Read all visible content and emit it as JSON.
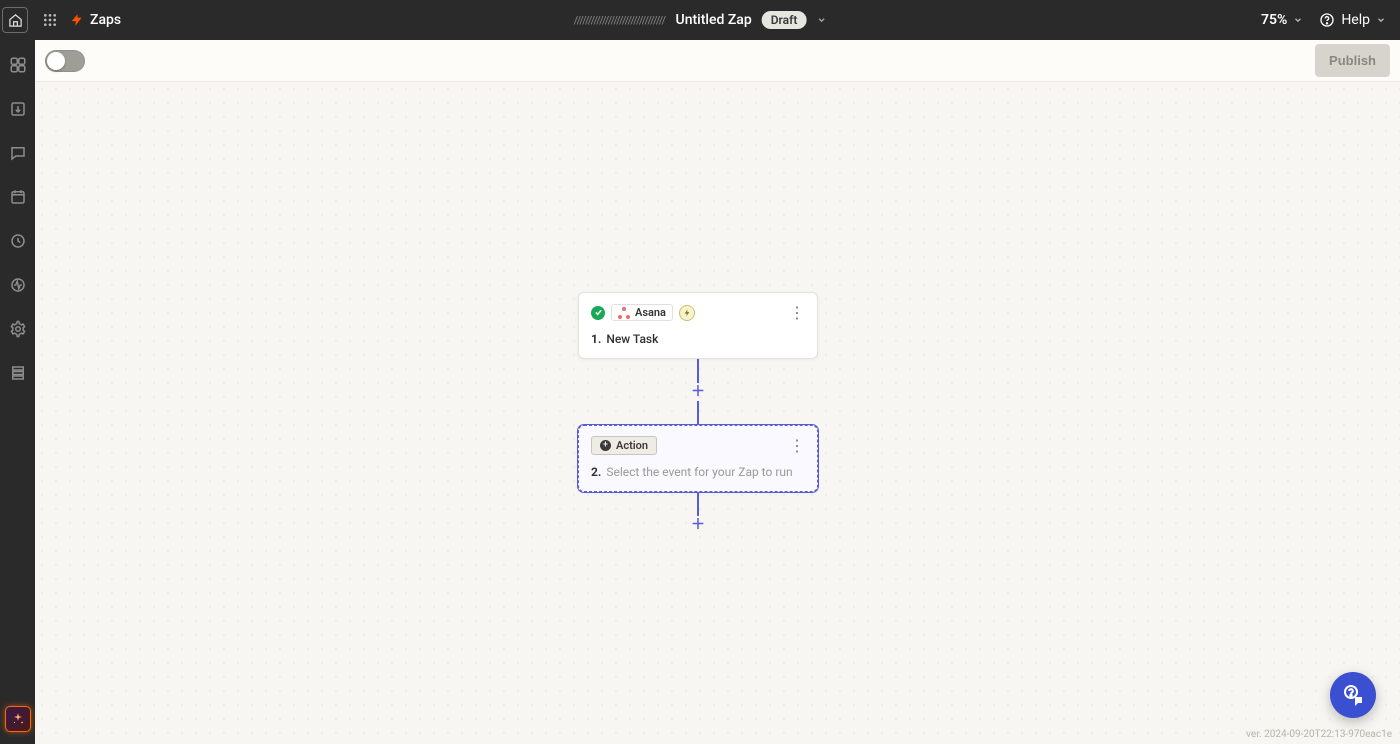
{
  "topbar": {
    "breadcrumb": "Zaps",
    "center_scribble": "////////////////////////////////",
    "title": "Untitled Zap",
    "status_badge": "Draft",
    "zoom_level": "75%",
    "help_label": "Help"
  },
  "subbar": {
    "enabled": false,
    "publish_label": "Publish"
  },
  "leftrail": {
    "icons": [
      "ai-command-icon",
      "import-icon",
      "comment-icon",
      "calendar-icon",
      "history-icon",
      "activity-icon",
      "settings-icon",
      "versions-icon"
    ]
  },
  "flow": {
    "steps": [
      {
        "index": "1.",
        "status": "ok",
        "app_name": "Asana",
        "trigger_badge": "⚡",
        "title": "New Task"
      },
      {
        "index": "2.",
        "status": "pending",
        "chip_label": "Action",
        "placeholder": "Select the event for your Zap to run",
        "selected": true
      }
    ]
  },
  "footer": {
    "version": "ver. 2024-09-20T22:13-970eac1e"
  }
}
